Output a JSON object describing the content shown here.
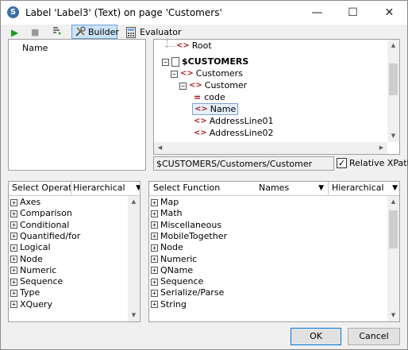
{
  "window": {
    "title": "Label 'Label3' (Text) on page 'Customers'",
    "app_icon": "S",
    "minimize": "—",
    "maximize": "☐",
    "close": "✕"
  },
  "toolbar": {
    "run_icon": "▶",
    "stop_icon": "■",
    "builder_label": "Builder",
    "evaluator_label": "Evaluator"
  },
  "expression": {
    "text": "Name"
  },
  "tree": {
    "root_label": "Root",
    "customers_var": "$CUSTOMERS",
    "customers": "Customers",
    "customer": "Customer",
    "code": "code",
    "name": "Name",
    "address1": "AddressLine01",
    "address2": "AddressLine02"
  },
  "path": {
    "value": "$CUSTOMERS/Customers/Customer",
    "relative_xpath": "Relative XPath",
    "relative_checked": true
  },
  "operators": {
    "header_label": "Select Operator:",
    "mode": "Hierarchical",
    "items": [
      "Axes",
      "Comparison",
      "Conditional",
      "Quantified/for",
      "Logical",
      "Node",
      "Numeric",
      "Sequence",
      "Type",
      "XQuery"
    ]
  },
  "functions": {
    "header_label": "Select Function",
    "names_mode": "Names",
    "mode": "Hierarchical",
    "items": [
      "Map",
      "Math",
      "Miscellaneous",
      "MobileTogether",
      "Node",
      "Numeric",
      "QName",
      "Sequence",
      "Serialize/Parse",
      "String"
    ]
  },
  "buttons": {
    "ok": "OK",
    "cancel": "Cancel"
  }
}
